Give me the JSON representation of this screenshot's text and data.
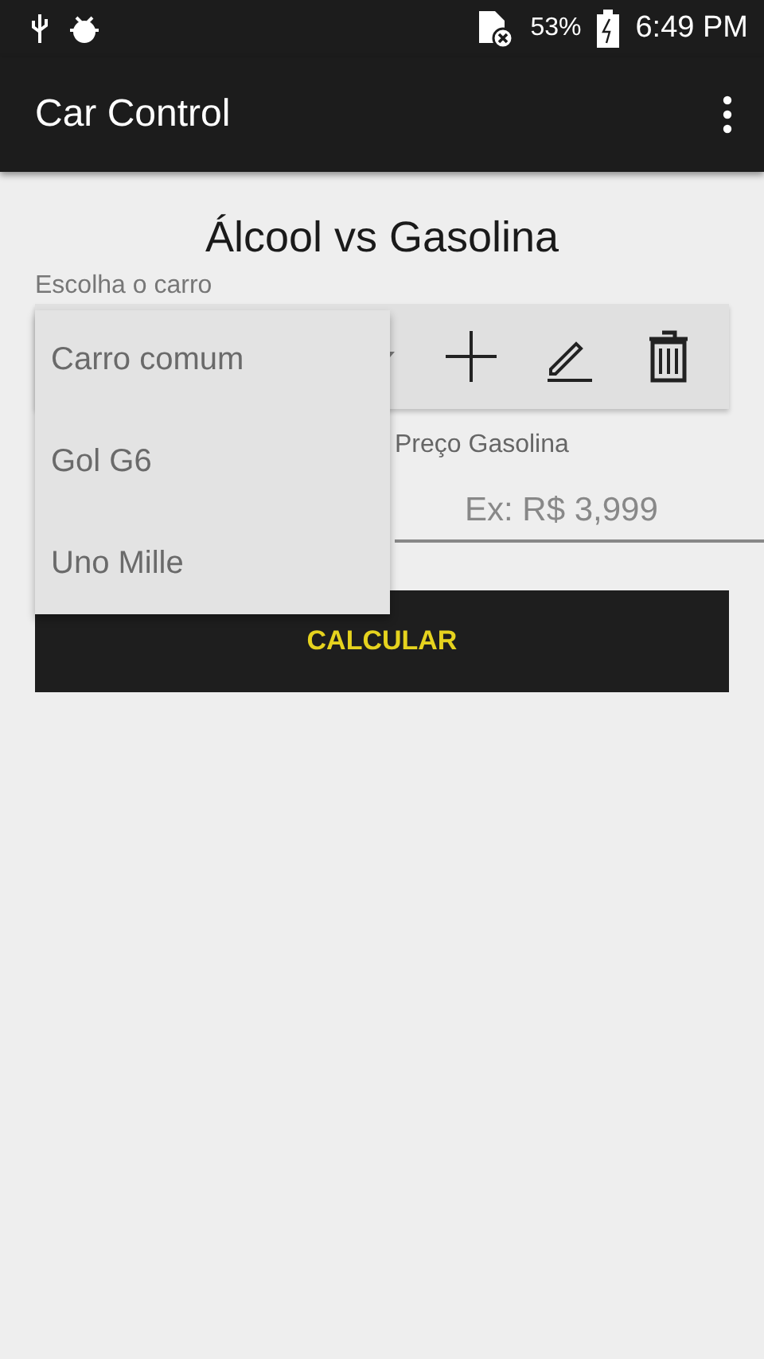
{
  "status_bar": {
    "battery": "53%",
    "time": "6:49 PM"
  },
  "app_bar": {
    "title": "Car Control"
  },
  "heading": "Álcool vs Gasolina",
  "car_label": "Escolha o carro",
  "dropdown": {
    "options": [
      {
        "label": "Carro comum"
      },
      {
        "label": "Gol G6"
      },
      {
        "label": "Uno Mille"
      }
    ]
  },
  "gas_field": {
    "label": "Preço Gasolina",
    "placeholder": "Ex: R$ 3,999"
  },
  "calculate_button": "CALCULAR"
}
